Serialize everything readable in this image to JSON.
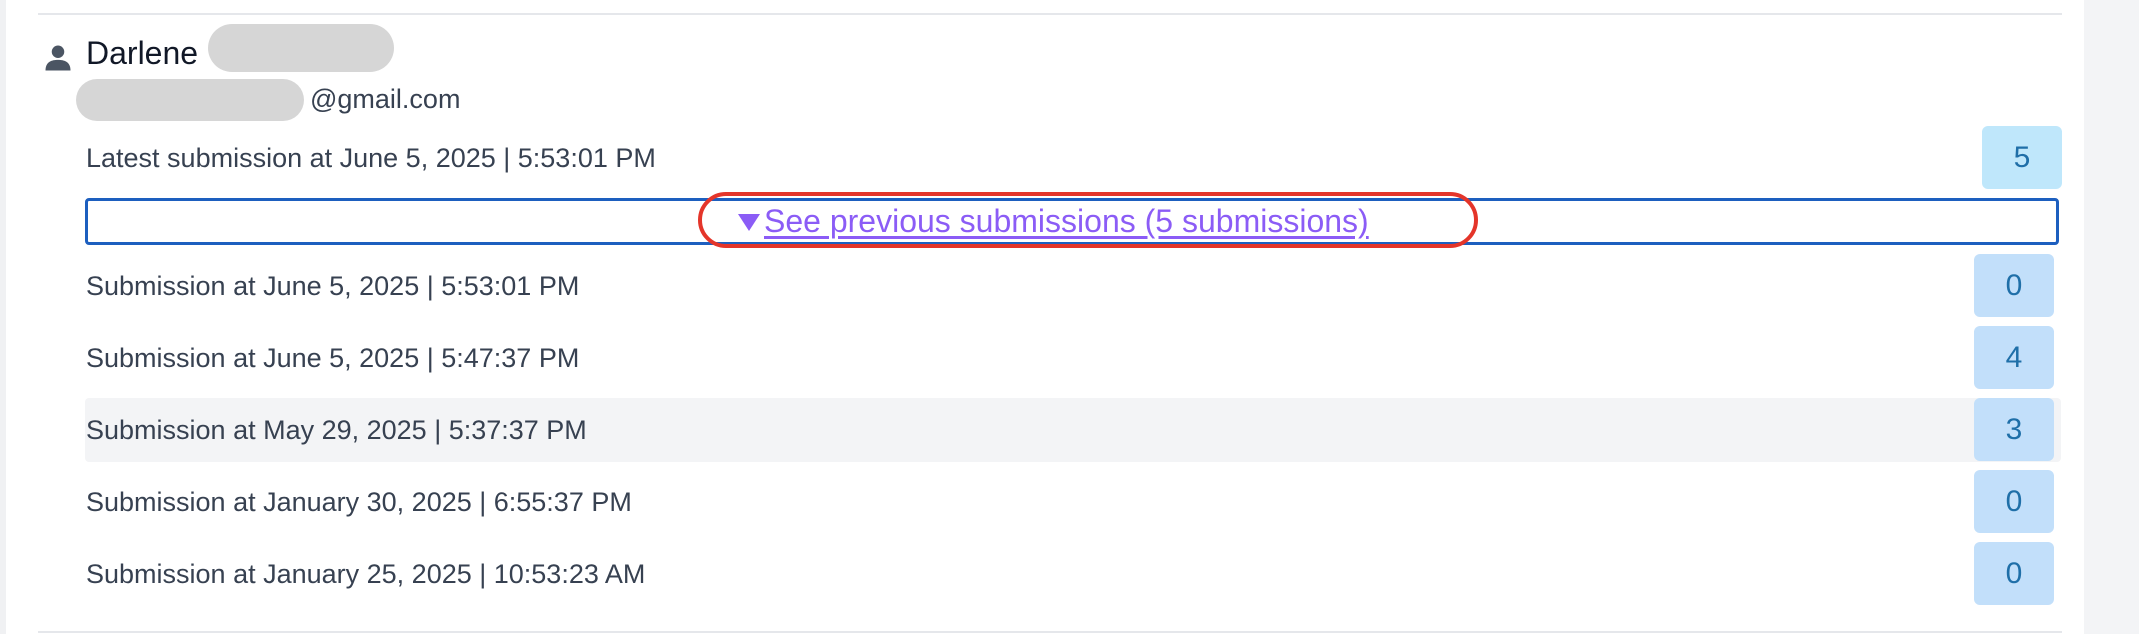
{
  "user": {
    "name": "Darlene",
    "email_domain": "@gmail.com"
  },
  "latest": {
    "label": "Latest submission at June 5, 2025 | 5:53:01 PM",
    "score": "5"
  },
  "toggle": {
    "label": "See previous submissions (5 submissions)"
  },
  "submissions": [
    {
      "label": "Submission at June 5, 2025 | 5:53:01 PM",
      "score": "0"
    },
    {
      "label": "Submission at June 5, 2025 | 5:47:37 PM",
      "score": "4"
    },
    {
      "label": "Submission at May 29, 2025 | 5:37:37 PM",
      "score": "3"
    },
    {
      "label": "Submission at January 30, 2025 | 6:55:37 PM",
      "score": "0"
    },
    {
      "label": "Submission at January 25, 2025 | 10:53:23 AM",
      "score": "0"
    }
  ],
  "colors": {
    "link": "#8b5cf6",
    "focus_border": "#1d5fbf",
    "annotation": "#e4352a",
    "score_bg": "#c2dffa",
    "score_text": "#1f6fa8"
  },
  "icons": {
    "user": "person-icon",
    "toggle": "triangle-down-icon"
  }
}
